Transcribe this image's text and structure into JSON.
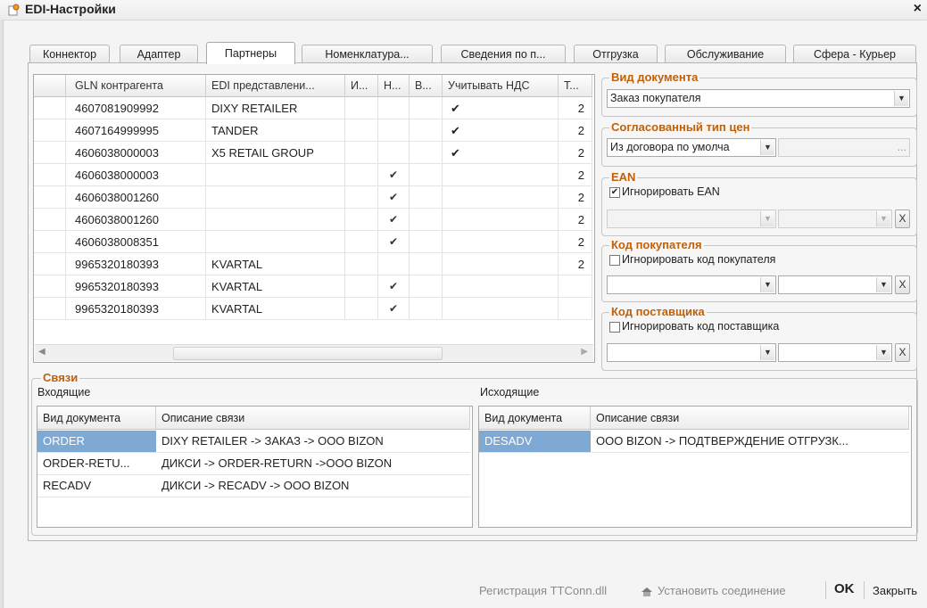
{
  "window": {
    "title": "EDI-Настройки",
    "close_glyph": "×",
    "icon": "settings-doc-icon"
  },
  "tabs": [
    {
      "label": "Коннектор"
    },
    {
      "label": "Адаптер"
    },
    {
      "label": "Партнеры"
    },
    {
      "label": "Номенклатура..."
    },
    {
      "label": "Сведения по п..."
    },
    {
      "label": "Отгрузка"
    },
    {
      "label": "Обслуживание"
    },
    {
      "label": "Сфера - Курьер"
    }
  ],
  "active_tab": "Партнеры",
  "partners_grid": {
    "columns": [
      "",
      "GLN контрагента",
      "EDI представлени...",
      "И...",
      "Н...",
      "В...",
      "Учитывать НДС",
      "Т..."
    ],
    "rows": [
      {
        "gln": "4607081909992",
        "edi": "DIXY RETAILER",
        "i": "",
        "n": "",
        "v": "",
        "nds": "✔",
        "t": "2"
      },
      {
        "gln": "4607164999995",
        "edi": "TANDER",
        "i": "",
        "n": "",
        "v": "",
        "nds": "✔",
        "t": "2"
      },
      {
        "gln": "4606038000003",
        "edi": "X5 RETAIL GROUP",
        "i": "",
        "n": "",
        "v": "",
        "nds": "✔",
        "t": "2"
      },
      {
        "gln": "4606038000003",
        "edi": "",
        "i": "",
        "n": "✔",
        "v": "",
        "nds": "",
        "t": "2"
      },
      {
        "gln": "4606038001260",
        "edi": "",
        "i": "",
        "n": "✔",
        "v": "",
        "nds": "",
        "t": "2"
      },
      {
        "gln": "4606038001260",
        "edi": "",
        "i": "",
        "n": "✔",
        "v": "",
        "nds": "",
        "t": "2"
      },
      {
        "gln": "4606038008351",
        "edi": "",
        "i": "",
        "n": "✔",
        "v": "",
        "nds": "",
        "t": "2"
      },
      {
        "gln": "9965320180393",
        "edi": "KVARTAL",
        "i": "",
        "n": "",
        "v": "",
        "nds": "",
        "t": "2"
      },
      {
        "gln": "9965320180393",
        "edi": "KVARTAL",
        "i": "",
        "n": "✔",
        "v": "",
        "nds": "",
        "t": ""
      },
      {
        "gln": "9965320180393",
        "edi": "KVARTAL",
        "i": "",
        "n": "✔",
        "v": "",
        "nds": "",
        "t": ""
      }
    ],
    "scroll_left": "◀",
    "scroll_right": "▶"
  },
  "doc_type": {
    "label": "Вид документа",
    "value": "Заказ покупателя"
  },
  "price_type": {
    "label": "Согласованный тип цен",
    "value": "Из договора по умолча",
    "ellipsis": "..."
  },
  "ean": {
    "label": "EAN",
    "checkbox_label": "Игнорировать EAN",
    "checked": true
  },
  "buyer_code": {
    "label": "Код покупателя",
    "checkbox_label": "Игнорировать код покупателя",
    "checked": false
  },
  "supplier_code": {
    "label": "Код поставщика",
    "checkbox_label": "Игнорировать код поставщика",
    "checked": false
  },
  "clear_glyph": "X",
  "dropdown_glyph": "▼",
  "links": {
    "label": "Связи",
    "incoming": {
      "label": "Входящие",
      "columns": [
        "Вид документа",
        "Описание связи"
      ],
      "rows": [
        {
          "doc": "ORDER",
          "desc": "DIXY RETAILER -> ЗАКАЗ -> OOO BIZON",
          "selected": true
        },
        {
          "doc": "ORDER-RETU...",
          "desc": "ДИКСИ -> ORDER-RETURN ->OOO BIZON",
          "selected": false
        },
        {
          "doc": "RECADV",
          "desc": "ДИКСИ -> RECADV -> OOO BIZON",
          "selected": false
        }
      ]
    },
    "outgoing": {
      "label": "Исходящие",
      "columns": [
        "Вид документа",
        "Описание связи"
      ],
      "rows": [
        {
          "doc": "DESADV",
          "desc": "OOO BIZON -> ПОДТВЕРЖДЕНИЕ ОТГРУЗК...",
          "selected": true
        }
      ]
    }
  },
  "footer": {
    "register": "Регистрация TTConn.dll",
    "connect": "Установить соединение",
    "ok": "OK",
    "close": "Закрыть"
  }
}
